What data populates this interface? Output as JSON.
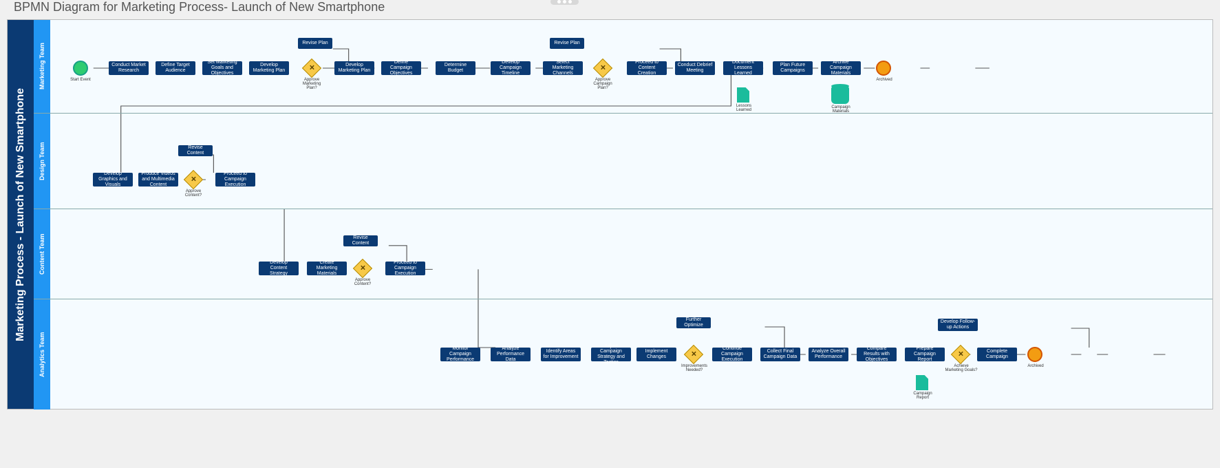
{
  "header": {
    "title": "BPMN Diagram for Marketing Process- Launch of New Smartphone"
  },
  "credit": "",
  "pool": {
    "label": "Marketing Process - Launch of New Smartphone"
  },
  "lanes": {
    "marketing": {
      "label": "Marketing Team",
      "start_event_label": "Start Event",
      "tasks": {
        "t1": "Conduct Market Research",
        "t2": "Define Target Audience",
        "t3": "Set Marketing Goals and Objectives",
        "t4": "Develop Marketing Plan",
        "revise_plan1": "Revise Plan",
        "t5": "Develop Marketing Plan",
        "t6": "Define Campaign Objectives",
        "t7": "Determine Budget",
        "t8": "Develop Campaign Timeline",
        "t9": "Select Marketing Channels",
        "revise_plan2": "Revise Plan",
        "t10": "Proceed to Content Creation",
        "t11": "Conduct Debrief Meeting",
        "t12": "Document Lessons Learned",
        "t13": "Plan Future Campaigns",
        "t14": "Archive Campaign Materials"
      },
      "gateways": {
        "g1_label": "Approve Marketing Plan?",
        "g2_label": "Approve Campaign Plan?"
      },
      "end_event_label": "Archived",
      "data": {
        "lessons_doc": "Lessons Learned",
        "materials_db": "Campaign Materials"
      }
    },
    "design": {
      "label": "Design Team",
      "tasks": {
        "d1": "Develop Graphics and Visuals",
        "d2": "Produce Videos and Multimedia Content",
        "revise": "Revise Content",
        "d3": "Proceed to Campaign Execution"
      },
      "gateway_label": "Approve Content?"
    },
    "content": {
      "label": "Content Team",
      "tasks": {
        "c1": "Develop Content Strategy",
        "c2": "Create Marketing Materials",
        "revise": "Revise Content",
        "c3": "Proceed to Campaign Execution"
      },
      "gateway_label": "Approve Content?"
    },
    "analytics": {
      "label": "Analytics Team",
      "tasks": {
        "a1": "Monitor Campaign Performance",
        "a2": "Analyze Performance Data",
        "a3": "Identify Areas for Improvement",
        "a4": "Adjust Campaign Strategy and Tactics",
        "a5": "Implement Changes",
        "optimize": "Further Optimize",
        "a6": "Continue Campaign Execution",
        "a7": "Collect Final Campaign Data",
        "a8": "Analyze Overall Performance",
        "a9": "Compare Results with Objectives",
        "a10": "Prepare Campaign Report",
        "followup": "Develop Follow-up Actions",
        "a11": "Complete Campaign"
      },
      "gateways": {
        "g1_label": "Improvements Needed?",
        "g2_label": "Achieve Marketing Goals?"
      },
      "end_event_label": "Archived",
      "data": {
        "report": "Campaign Report"
      }
    }
  }
}
